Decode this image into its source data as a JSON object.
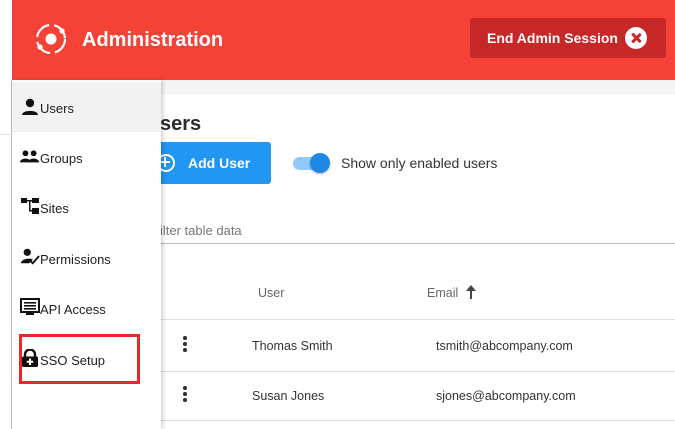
{
  "header": {
    "title": "Administration",
    "logo_icon": "atom-logo-icon",
    "end_session_label": "End Admin Session",
    "end_session_icon": "close-circle-icon",
    "bg_color": "#f44336",
    "button_color": "#c62828"
  },
  "sidebar": {
    "items": [
      {
        "label": "Users",
        "icon": "user-icon",
        "active": true
      },
      {
        "label": "Groups",
        "icon": "group-icon"
      },
      {
        "label": "Sites",
        "icon": "sitemap-icon"
      },
      {
        "label": "Permissions",
        "icon": "user-check-icon"
      },
      {
        "label": "API Access",
        "icon": "keyboard-icon"
      },
      {
        "label": "SSO Setup",
        "icon": "lock-plus-icon",
        "highlighted": true
      }
    ]
  },
  "main": {
    "title": "sers",
    "add_user_label": "Add User",
    "toggle": {
      "label": "Show only enabled users",
      "enabled": true
    },
    "filter_placeholder": "ilter table data",
    "table": {
      "columns": [
        "User",
        "Email"
      ],
      "sort_column": "Email",
      "sort_direction": "ascending",
      "rows": [
        {
          "user": "Thomas Smith",
          "email": "tsmith@abcompany.com"
        },
        {
          "user": "Susan Jones",
          "email": "sjones@abcompany.com"
        }
      ]
    },
    "accent_color": "#2196f3"
  }
}
